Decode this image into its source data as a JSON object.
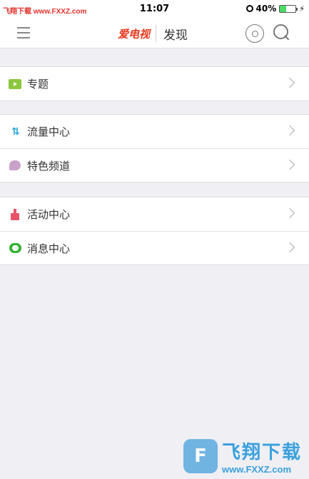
{
  "status_bar": {
    "left_text": "飞翔下载 www.FXXZ.com",
    "time": "11:07",
    "battery_percent": "40%",
    "battery_level": 0.4
  },
  "nav": {
    "logo_text": "爱电视",
    "title": "发现",
    "menu_icon": "hamburger-menu-icon",
    "remote_icon": "remote-control-icon",
    "search_icon": "search-icon"
  },
  "groups": [
    {
      "items": [
        {
          "label": "专题",
          "icon": "topic-icon"
        }
      ]
    },
    {
      "items": [
        {
          "label": "流量中心",
          "icon": "traffic-icon"
        },
        {
          "label": "特色频道",
          "icon": "channel-icon"
        }
      ]
    },
    {
      "items": [
        {
          "label": "活动中心",
          "icon": "activity-icon"
        },
        {
          "label": "消息中心",
          "icon": "message-icon"
        }
      ]
    }
  ],
  "watermark": {
    "brand": "飞翔下载",
    "url": "www.FXXZ.com"
  },
  "colors": {
    "background": "#efeff4",
    "accent_red": "#e8381c",
    "topic_green": "#8cc63f",
    "traffic_blue": "#29a9d8",
    "message_green": "#34b233"
  }
}
